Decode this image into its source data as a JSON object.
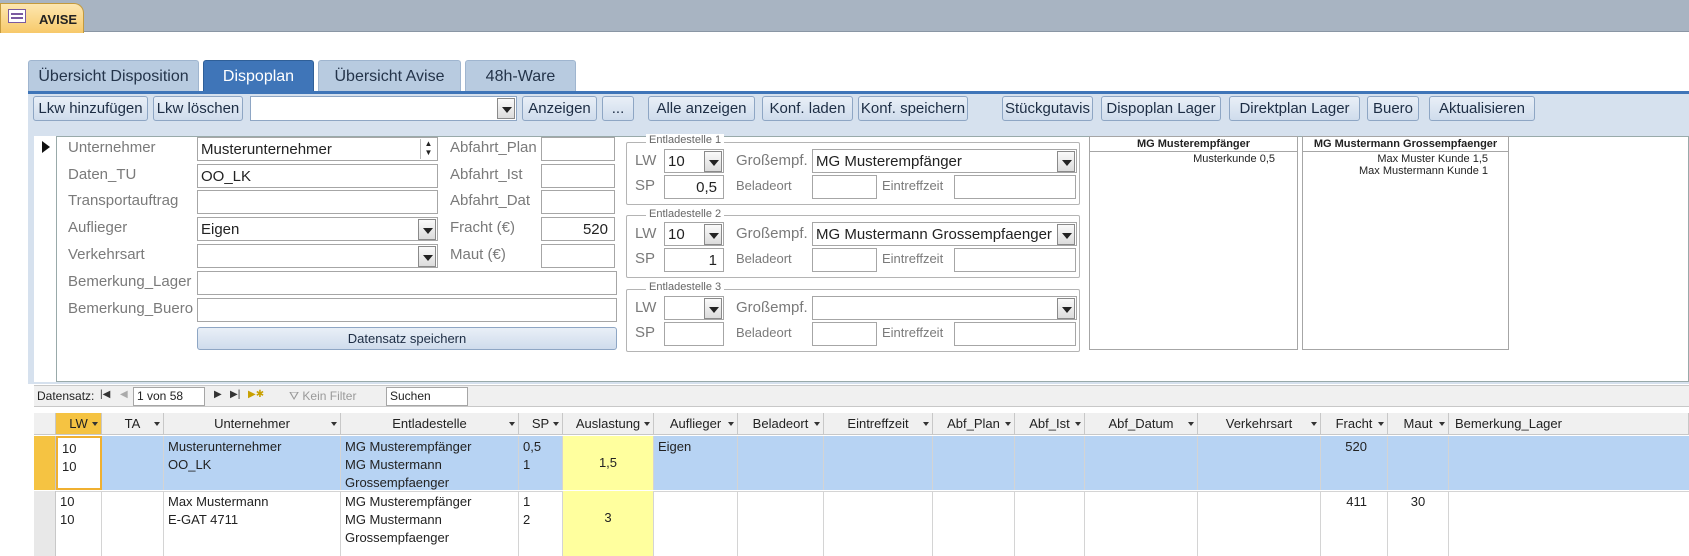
{
  "window": {
    "tab_title": "AVISE"
  },
  "tabs": [
    {
      "label": "Übersicht Disposition",
      "active": false
    },
    {
      "label": "Dispoplan",
      "active": true
    },
    {
      "label": "Übersicht Avise",
      "active": false
    },
    {
      "label": "48h-Ware",
      "active": false
    }
  ],
  "toolbar": {
    "lkw_add": "Lkw hinzufügen",
    "lkw_delete": "Lkw löschen",
    "combo_value": "",
    "show": "Anzeigen",
    "ellipsis": "...",
    "show_all": "Alle anzeigen",
    "conf_load": "Konf. laden",
    "conf_save": "Konf. speichern",
    "stueckgut": "Stückgutavis",
    "dispo_lager": "Dispoplan Lager",
    "direkt_lager": "Direktplan Lager",
    "buero": "Buero",
    "refresh": "Aktualisieren"
  },
  "form": {
    "unternehmer": {
      "label": "Unternehmer",
      "value": "Musterunternehmer"
    },
    "daten_tu": {
      "label": "Daten_TU",
      "value": "OO_LK"
    },
    "transportauftrag": {
      "label": "Transportauftrag",
      "value": ""
    },
    "auflieger": {
      "label": "Auflieger",
      "value": "Eigen"
    },
    "verkehrsart": {
      "label": "Verkehrsart",
      "value": ""
    },
    "bemerkung_lager": {
      "label": "Bemerkung_Lager",
      "value": ""
    },
    "bemerkung_buero": {
      "label": "Bemerkung_Buero",
      "value": ""
    },
    "abfahrt_plan": {
      "label": "Abfahrt_Plan",
      "value": ""
    },
    "abfahrt_ist": {
      "label": "Abfahrt_Ist",
      "value": ""
    },
    "abfahrt_dat": {
      "label": "Abfahrt_Dat",
      "value": ""
    },
    "fracht": {
      "label": "Fracht (€)",
      "value": "520"
    },
    "maut": {
      "label": "Maut (€)",
      "value": ""
    },
    "save_button": "Datensatz speichern"
  },
  "entladestellen": [
    {
      "title": "Entladestelle 1",
      "lw_label": "LW",
      "lw": "10",
      "sp_label": "SP",
      "sp": "0,5",
      "gross_label": "Großempf.",
      "gross": "MG Musterempfänger",
      "beladeort_label": "Beladeort",
      "beladeort": "",
      "eintreff_label": "Eintreffzeit",
      "eintreff": ""
    },
    {
      "title": "Entladestelle 2",
      "lw_label": "LW",
      "lw": "10",
      "sp_label": "SP",
      "sp": "1",
      "gross_label": "Großempf.",
      "gross": "MG Mustermann Grossempfaenger",
      "beladeort_label": "Beladeort",
      "beladeort": "",
      "eintreff_label": "Eintreffzeit",
      "eintreff": ""
    },
    {
      "title": "Entladestelle 3",
      "lw_label": "LW",
      "lw": "",
      "sp_label": "SP",
      "sp": "",
      "gross_label": "Großempf.",
      "gross": "",
      "beladeort_label": "Beladeort",
      "beladeort": "",
      "eintreff_label": "Eintreffzeit",
      "eintreff": ""
    }
  ],
  "summary": [
    {
      "title": "MG Musterempfänger",
      "lines": [
        "Musterkunde  0,5"
      ]
    },
    {
      "title": "MG Mustermann Grossempfaenger",
      "lines": [
        "Max Muster Kunde  1,5",
        "Max Mustermann Kunde  1"
      ]
    }
  ],
  "record_nav": {
    "label": "Datensatz:",
    "position": "1 von 58",
    "filter": "Kein Filter",
    "search": "Suchen"
  },
  "grid": {
    "columns": [
      "LW",
      "TA",
      "Unternehmer",
      "Entladestelle",
      "SP",
      "Auslastung",
      "Auflieger",
      "Beladeort",
      "Eintreffzeit",
      "Abf_Plan",
      "Abf_Ist",
      "Abf_Datum",
      "Verkehrsart",
      "Fracht",
      "Maut",
      "Bemerkung_Lager"
    ],
    "rows": [
      {
        "lw": "10\n10",
        "ta": "",
        "unternehmer": "Musterunternehmer\nOO_LK",
        "entladestelle": "MG Musterempfänger\nMG Mustermann\nGrossempfaenger",
        "sp": "0,5\n1",
        "auslastung": "1,5",
        "auflieger": "Eigen",
        "fracht": "520",
        "maut": ""
      },
      {
        "lw": "10\n10",
        "ta": "",
        "unternehmer": "Max Mustermann\nE-GAT 4711",
        "entladestelle": "MG Musterempfänger\nMG Mustermann\nGrossempfaenger",
        "sp": "1\n2",
        "auslastung": "3",
        "auflieger": "",
        "fracht": "411",
        "maut": "30"
      }
    ]
  }
}
